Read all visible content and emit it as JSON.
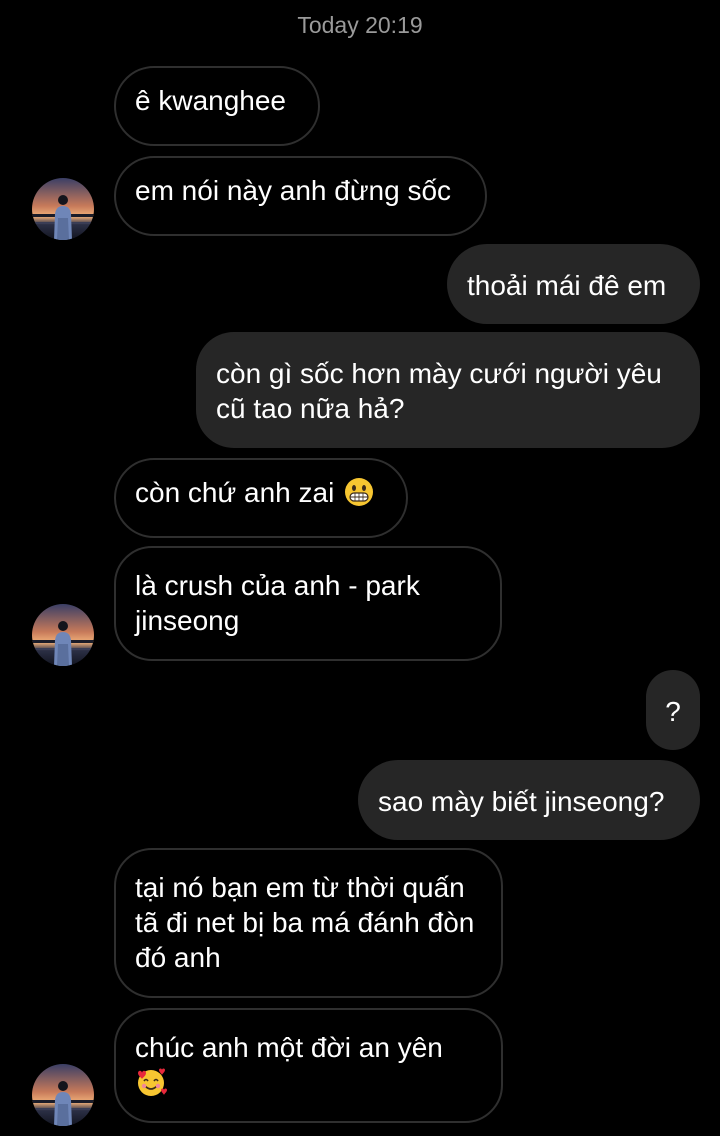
{
  "header": {
    "timestamp": "Today 20:19"
  },
  "colors": {
    "background": "#000000",
    "incoming_border": "#2f2f2f",
    "outgoing_bubble": "#262626",
    "timestamp_text": "#9a9a9a",
    "message_text": "#ffffff"
  },
  "messages": [
    {
      "direction": "incoming",
      "text": "ê kwanghee"
    },
    {
      "direction": "incoming",
      "text": "em nói này anh đừng sốc",
      "avatar": true
    },
    {
      "direction": "outgoing",
      "text": "thoải mái đê em"
    },
    {
      "direction": "outgoing",
      "text": "còn gì sốc hơn mày cưới người yêu cũ tao nữa hả?"
    },
    {
      "direction": "incoming",
      "text": "còn chứ anh zai",
      "emoji": "grinning-face-emoji"
    },
    {
      "direction": "incoming",
      "text": "là crush của anh - park jinseong",
      "avatar": true
    },
    {
      "direction": "outgoing",
      "text": "?"
    },
    {
      "direction": "outgoing",
      "text": "sao mày biết jinseong?"
    },
    {
      "direction": "incoming",
      "text": "tại nó bạn em từ thời quấn tã đi net bị ba má đánh đòn đó anh"
    },
    {
      "direction": "incoming",
      "text": "chúc anh một đời an yên",
      "emoji": "smiling-face-with-hearts-emoji",
      "avatar": true
    }
  ]
}
